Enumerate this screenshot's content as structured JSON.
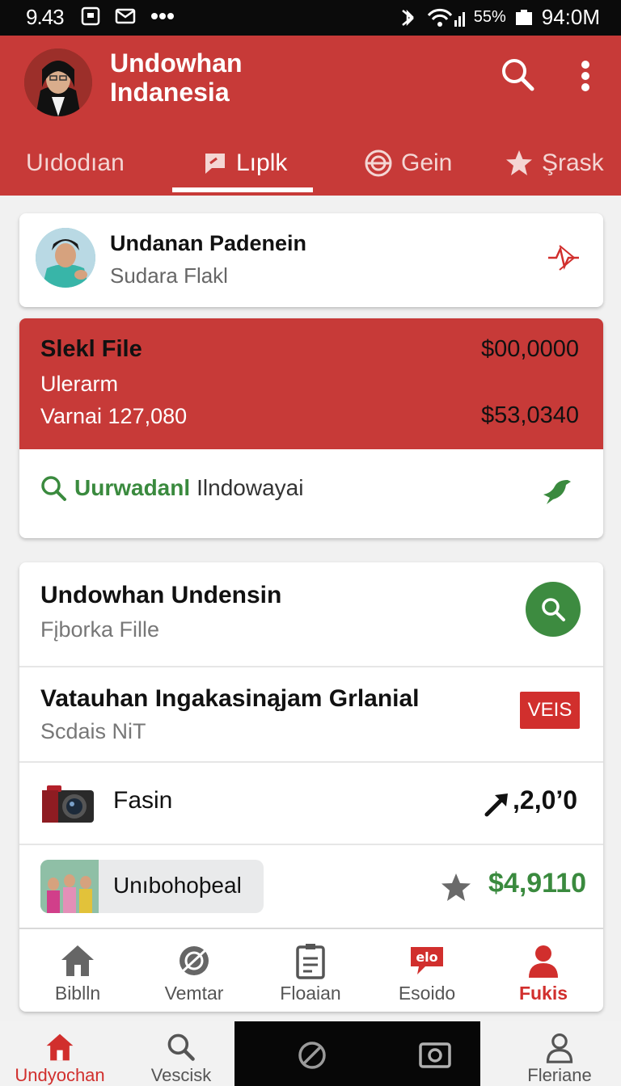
{
  "status_bar": {
    "time": "9.43",
    "battery": "55%",
    "clock_right": "94:0M"
  },
  "header": {
    "title": "Undowhan Indanesia",
    "search_icon": "search-icon",
    "more_icon": "more-vertical-icon"
  },
  "tabs": [
    {
      "label": "Uıdodıan",
      "icon": ""
    },
    {
      "label": "Lıplk",
      "icon": "chat-icon"
    },
    {
      "label": "Gein",
      "icon": "globe-icon"
    },
    {
      "label": "Şrask",
      "icon": "star-icon"
    }
  ],
  "profile_card": {
    "name": "Undanan Padenein",
    "subtitle": "Sudara Flakl",
    "action_icon": "pulse-icon"
  },
  "file_card": {
    "title": "Slekl File",
    "amount_top": "$00,0000",
    "label": "Ulerarm",
    "variant": "Varnai 127,080",
    "amount_bottom": "$53,0340",
    "search_highlight": "Uurwadanl",
    "search_rest": " Ilndowayai"
  },
  "list": {
    "row1": {
      "title": "Undowhan Undensin",
      "subtitle": "Fįborka Fille"
    },
    "row2": {
      "title": "Vatauhan Ingakasinąjam Grlanial",
      "subtitle": "Scdais NiT",
      "badge": "VEIS"
    },
    "row3": {
      "label": "Fasin",
      "value": ",2,0’0"
    },
    "row4": {
      "chip_label": "Unıbohoþeal",
      "value": "$4,9110"
    }
  },
  "inner_nav": [
    {
      "label": "Biblln",
      "icon": "home-icon"
    },
    {
      "label": "Vemtar",
      "icon": "compass-icon"
    },
    {
      "label": "Floaian",
      "icon": "document-icon"
    },
    {
      "label": "Esoido",
      "icon": "chat-bubble-icon",
      "bubble_text": "elo"
    },
    {
      "label": "Fukis",
      "icon": "person-icon"
    }
  ],
  "bottom_nav": [
    {
      "label": "Undyochan",
      "icon": "home-icon"
    },
    {
      "label": "Vescisk",
      "icon": "search-icon"
    },
    {
      "label": "",
      "icon": "block-icon"
    },
    {
      "label": "",
      "icon": "camera-icon"
    },
    {
      "label": "Fleriane",
      "icon": "person-icon"
    }
  ],
  "colors": {
    "brand_red": "#c73a38",
    "accent_green": "#3a8a3e"
  }
}
